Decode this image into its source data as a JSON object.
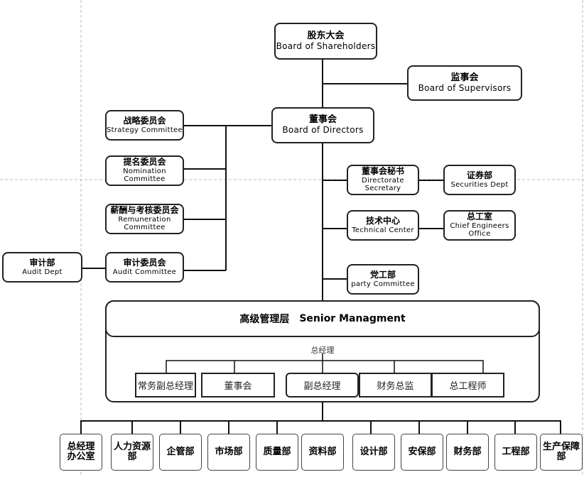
{
  "nodes": {
    "shareholders": {
      "zh": "股东大会",
      "en": "Board of Shareholders"
    },
    "supervisors": {
      "zh": "监事会",
      "en": "Board of Supervisors"
    },
    "directors": {
      "zh": "董事会",
      "en": "Board of Directors"
    },
    "strategy": {
      "zh": "战略委员会",
      "en": "Strategy Committee"
    },
    "nomination": {
      "zh": "提名委员会",
      "en1": "Nomination",
      "en2": "Committee"
    },
    "remuneration": {
      "zh": "薪酬与考核委员会",
      "en1": "Remuneration",
      "en2": "Committee"
    },
    "audit_committee": {
      "zh": "审计委员会",
      "en": "Audit Committee"
    },
    "audit_dept": {
      "zh": "审计部",
      "en": "Audit Dept"
    },
    "directorate_secretary": {
      "zh": "董事会秘书",
      "en1": "Directorate",
      "en2": "Secretary"
    },
    "securities": {
      "zh": "证券部",
      "en": "Securities Dept"
    },
    "technical_center": {
      "zh": "技术中心",
      "en": "Technical Center"
    },
    "chief_engineers": {
      "zh": "总工室",
      "en1": "Chief Engineers",
      "en2": "Office"
    },
    "party": {
      "zh": "党工部",
      "en": "party Committee"
    }
  },
  "senior": {
    "title_zh": "高级管理层",
    "title_en": "Senior Managment",
    "gm_label": "总经理",
    "managers": [
      "常务副总经理",
      "董事会",
      "副总经理",
      "财务总监",
      "总工程师"
    ]
  },
  "departments": [
    {
      "l1": "总经理",
      "l2": "办公室"
    },
    {
      "l1": "人力资源",
      "l2": "部"
    },
    {
      "l1": "企管部",
      "l2": ""
    },
    {
      "l1": "市场部",
      "l2": ""
    },
    {
      "l1": "质量部",
      "l2": ""
    },
    {
      "l1": "资料部",
      "l2": ""
    },
    {
      "l1": "设计部",
      "l2": ""
    },
    {
      "l1": "安保部",
      "l2": ""
    },
    {
      "l1": "财务部",
      "l2": ""
    },
    {
      "l1": "工程部",
      "l2": ""
    },
    {
      "l1": "生产保障",
      "l2": "部"
    }
  ]
}
